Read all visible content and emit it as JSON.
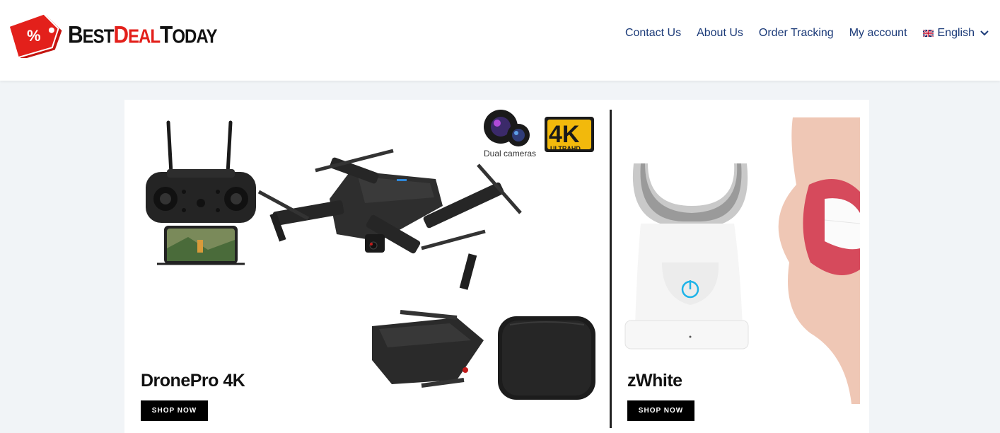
{
  "brand": {
    "logo_tag_symbol": "%",
    "best_part1": "B",
    "best_part2": "EST",
    "deal_part1": "D",
    "deal_part2": "EAL",
    "today_part1": "T",
    "today_part2": "ODAY",
    "colors": {
      "red": "#e3201b",
      "black": "#111111"
    }
  },
  "nav": {
    "items": [
      "Contact Us",
      "About Us",
      "Order Tracking",
      "My account"
    ],
    "language": "English",
    "language_icon": "uk-flag-icon",
    "link_color": "#1b3a78"
  },
  "products": [
    {
      "title": "DronePro 4K",
      "button": "SHOP NOW",
      "badge_main": "4K",
      "badge_sub": "ULTRAHD",
      "cameras_caption": "Dual cameras"
    },
    {
      "title": "zWhite",
      "button": "SHOP NOW"
    }
  ]
}
